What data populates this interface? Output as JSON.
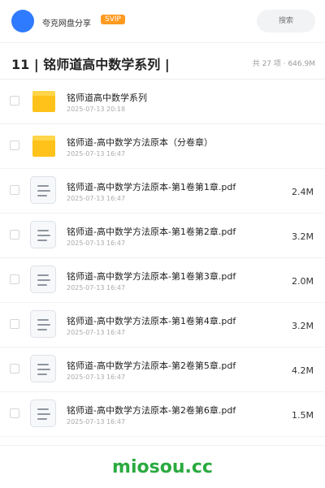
{
  "header": {
    "user_name": "夸克网盘分享",
    "vip_badge": "SVIP",
    "search_placeholder": "搜索"
  },
  "title_bar": {
    "title": "11 | 铭师道高中数学系列 |",
    "meta": "共 27 项 · 646.9M"
  },
  "files": [
    {
      "type": "folder",
      "name": "铭师道高中数学系列",
      "date": "2025-07-13 20:18",
      "size": ""
    },
    {
      "type": "folder",
      "name": "铭师道-高中数学方法原本（分卷章）",
      "date": "2025-07-13 16:47",
      "size": ""
    },
    {
      "type": "file",
      "name": "铭师道-高中数学方法原本-第1卷第1章.pdf",
      "date": "2025-07-13 16:47",
      "size": "2.4M"
    },
    {
      "type": "file",
      "name": "铭师道-高中数学方法原本-第1卷第2章.pdf",
      "date": "2025-07-13 16:47",
      "size": "3.2M"
    },
    {
      "type": "file",
      "name": "铭师道-高中数学方法原本-第1卷第3章.pdf",
      "date": "2025-07-13 16:47",
      "size": "2.0M"
    },
    {
      "type": "file",
      "name": "铭师道-高中数学方法原本-第1卷第4章.pdf",
      "date": "2025-07-13 16:47",
      "size": "3.2M"
    },
    {
      "type": "file",
      "name": "铭师道-高中数学方法原本-第2卷第5章.pdf",
      "date": "2025-07-13 16:47",
      "size": "4.2M"
    },
    {
      "type": "file",
      "name": "铭师道-高中数学方法原本-第2卷第6章.pdf",
      "date": "2025-07-13 16:47",
      "size": "1.5M"
    }
  ],
  "footer": {
    "brand": "miosou.cc"
  },
  "colors": {
    "avatar": "#2f7bff",
    "vip": "#ff9a1f",
    "folder": "#ffc21a",
    "brand": "#2aaa3f"
  }
}
